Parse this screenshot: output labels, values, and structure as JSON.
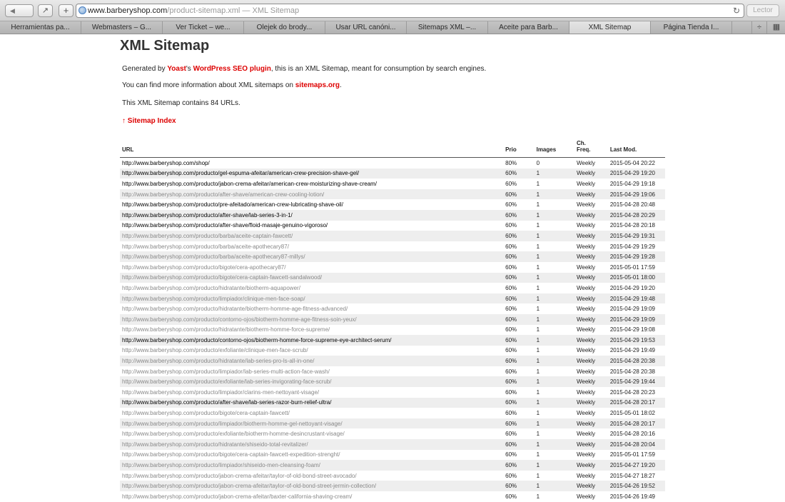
{
  "browser": {
    "address_host": "www.barberyshop.com",
    "address_path": "/product-sitemap.xml — XML Sitemap",
    "reader_label": "Lector",
    "tabs": [
      {
        "label": "Herramientas pa...",
        "active": false
      },
      {
        "label": "Webmasters – G...",
        "active": false
      },
      {
        "label": "Ver Ticket – we...",
        "active": false
      },
      {
        "label": "Olejek do brody...",
        "active": false
      },
      {
        "label": "Usar URL canóni...",
        "active": false
      },
      {
        "label": "Sitemaps XML –...",
        "active": false
      },
      {
        "label": "Aceite para Barb...",
        "active": false
      },
      {
        "label": "XML Sitemap",
        "active": true
      },
      {
        "label": "Página Tienda I...",
        "active": false
      }
    ]
  },
  "page": {
    "title": "XML Sitemap",
    "intro": {
      "pre": "Generated by ",
      "link1": "Yoast",
      "mid": "'s ",
      "link2": "WordPress SEO plugin",
      "post": ", this is an XML Sitemap, meant for consumption by search engines."
    },
    "info": {
      "pre": "You can find more information about XML sitemaps on ",
      "link": "sitemaps.org",
      "post": "."
    },
    "count_text": "This XML Sitemap contains 84 URLs.",
    "index_link": "↑ Sitemap Index"
  },
  "table": {
    "headers": {
      "url": "URL",
      "prio": "Prio",
      "images": "Images",
      "freq_line1": "Ch.",
      "freq_line2": "Freq.",
      "mod": "Last Mod."
    },
    "rows": [
      {
        "url": "http://www.barberyshop.com/shop/",
        "prio": "80%",
        "images": "0",
        "freq": "Weekly",
        "mod": "2015-05-04 20:22",
        "visited": false
      },
      {
        "url": "http://www.barberyshop.com/producto/gel-espuma-afeitar/american-crew-precision-shave-gel/",
        "prio": "60%",
        "images": "1",
        "freq": "Weekly",
        "mod": "2015-04-29 19:20",
        "visited": false
      },
      {
        "url": "http://www.barberyshop.com/producto/jabon-crema-afeitar/american-crew-moisturizing-shave-cream/",
        "prio": "60%",
        "images": "1",
        "freq": "Weekly",
        "mod": "2015-04-29 19:18",
        "visited": false
      },
      {
        "url": "http://www.barberyshop.com/producto/after-shave/american-crew-cooling-lotion/",
        "prio": "60%",
        "images": "1",
        "freq": "Weekly",
        "mod": "2015-04-29 19:06",
        "visited": true
      },
      {
        "url": "http://www.barberyshop.com/producto/pre-afeitado/american-crew-lubricating-shave-oil/",
        "prio": "60%",
        "images": "1",
        "freq": "Weekly",
        "mod": "2015-04-28 20:48",
        "visited": false
      },
      {
        "url": "http://www.barberyshop.com/producto/after-shave/lab-series-3-in-1/",
        "prio": "60%",
        "images": "1",
        "freq": "Weekly",
        "mod": "2015-04-28 20:29",
        "visited": false
      },
      {
        "url": "http://www.barberyshop.com/producto/after-shave/floid-masaje-genuino-vigoroso/",
        "prio": "60%",
        "images": "1",
        "freq": "Weekly",
        "mod": "2015-04-28 20:18",
        "visited": false
      },
      {
        "url": "http://www.barberyshop.com/producto/barba/aceite-captain-fawcett/",
        "prio": "60%",
        "images": "1",
        "freq": "Weekly",
        "mod": "2015-04-29 19:31",
        "visited": true
      },
      {
        "url": "http://www.barberyshop.com/producto/barba/aceite-apothecary87/",
        "prio": "60%",
        "images": "1",
        "freq": "Weekly",
        "mod": "2015-04-29 19:29",
        "visited": true
      },
      {
        "url": "http://www.barberyshop.com/producto/barba/aceite-apothecary87-millys/",
        "prio": "60%",
        "images": "1",
        "freq": "Weekly",
        "mod": "2015-04-29 19:28",
        "visited": true
      },
      {
        "url": "http://www.barberyshop.com/producto/bigote/cera-apothecary87/",
        "prio": "60%",
        "images": "1",
        "freq": "Weekly",
        "mod": "2015-05-01 17:59",
        "visited": true
      },
      {
        "url": "http://www.barberyshop.com/producto/bigote/cera-captain-fawcett-sandalwood/",
        "prio": "60%",
        "images": "1",
        "freq": "Weekly",
        "mod": "2015-05-01 18:00",
        "visited": true
      },
      {
        "url": "http://www.barberyshop.com/producto/hidratante/biotherm-aquapower/",
        "prio": "60%",
        "images": "1",
        "freq": "Weekly",
        "mod": "2015-04-29 19:20",
        "visited": true
      },
      {
        "url": "http://www.barberyshop.com/producto/limpiador/clinique-men-face-soap/",
        "prio": "60%",
        "images": "1",
        "freq": "Weekly",
        "mod": "2015-04-29 19:48",
        "visited": true
      },
      {
        "url": "http://www.barberyshop.com/producto/hidratante/biotherm-homme-age-fitness-advanced/",
        "prio": "60%",
        "images": "1",
        "freq": "Weekly",
        "mod": "2015-04-29 19:09",
        "visited": true
      },
      {
        "url": "http://www.barberyshop.com/producto/contorno-ojos/biotherm-homme-age-fitness-soin-yeux/",
        "prio": "60%",
        "images": "1",
        "freq": "Weekly",
        "mod": "2015-04-29 19:09",
        "visited": true
      },
      {
        "url": "http://www.barberyshop.com/producto/hidratante/biotherm-homme-force-supreme/",
        "prio": "60%",
        "images": "1",
        "freq": "Weekly",
        "mod": "2015-04-29 19:08",
        "visited": true
      },
      {
        "url": "http://www.barberyshop.com/producto/contorno-ojos/biotherm-homme-force-supreme-eye-architect-serum/",
        "prio": "60%",
        "images": "1",
        "freq": "Weekly",
        "mod": "2015-04-29 19:53",
        "visited": false
      },
      {
        "url": "http://www.barberyshop.com/producto/exfoliante/clinique-men-face-scrub/",
        "prio": "60%",
        "images": "1",
        "freq": "Weekly",
        "mod": "2015-04-29 19:49",
        "visited": true
      },
      {
        "url": "http://www.barberyshop.com/producto/hidratante/lab-series-pro-ls-all-in-one/",
        "prio": "60%",
        "images": "1",
        "freq": "Weekly",
        "mod": "2015-04-28 20:38",
        "visited": true
      },
      {
        "url": "http://www.barberyshop.com/producto/limpiador/lab-series-multi-action-face-wash/",
        "prio": "60%",
        "images": "1",
        "freq": "Weekly",
        "mod": "2015-04-28 20:38",
        "visited": true
      },
      {
        "url": "http://www.barberyshop.com/producto/exfoliante/lab-series-invigorating-face-scrub/",
        "prio": "60%",
        "images": "1",
        "freq": "Weekly",
        "mod": "2015-04-29 19:44",
        "visited": true
      },
      {
        "url": "http://www.barberyshop.com/producto/limpiador/clarins-men-nettoyant-visage/",
        "prio": "60%",
        "images": "1",
        "freq": "Weekly",
        "mod": "2015-04-28 20:23",
        "visited": true
      },
      {
        "url": "http://www.barberyshop.com/producto/after-shave/lab-series-razor-burn-relief-ultra/",
        "prio": "60%",
        "images": "1",
        "freq": "Weekly",
        "mod": "2015-04-28 20:17",
        "visited": false
      },
      {
        "url": "http://www.barberyshop.com/producto/bigote/cera-captain-fawcett/",
        "prio": "60%",
        "images": "1",
        "freq": "Weekly",
        "mod": "2015-05-01 18:02",
        "visited": true
      },
      {
        "url": "http://www.barberyshop.com/producto/limpiador/biotherm-homme-gel-nettoyant-visage/",
        "prio": "60%",
        "images": "1",
        "freq": "Weekly",
        "mod": "2015-04-28 20:17",
        "visited": true
      },
      {
        "url": "http://www.barberyshop.com/producto/exfoliante/biotherm-homme-desincrustant-visage/",
        "prio": "60%",
        "images": "1",
        "freq": "Weekly",
        "mod": "2015-04-28 20:16",
        "visited": true
      },
      {
        "url": "http://www.barberyshop.com/producto/hidratante/shiseido-total-revitalizer/",
        "prio": "60%",
        "images": "1",
        "freq": "Weekly",
        "mod": "2015-04-28 20:04",
        "visited": true
      },
      {
        "url": "http://www.barberyshop.com/producto/bigote/cera-captain-fawcett-expedition-strenght/",
        "prio": "60%",
        "images": "1",
        "freq": "Weekly",
        "mod": "2015-05-01 17:59",
        "visited": true
      },
      {
        "url": "http://www.barberyshop.com/producto/limpiador/shiseido-men-cleansing-foam/",
        "prio": "60%",
        "images": "1",
        "freq": "Weekly",
        "mod": "2015-04-27 19:20",
        "visited": true
      },
      {
        "url": "http://www.barberyshop.com/producto/jabon-crema-afeitar/taylor-of-old-bond-street-avocado/",
        "prio": "60%",
        "images": "1",
        "freq": "Weekly",
        "mod": "2015-04-27 18:27",
        "visited": true
      },
      {
        "url": "http://www.barberyshop.com/producto/jabon-crema-afeitar/taylor-of-old-bond-street-jermin-collection/",
        "prio": "60%",
        "images": "1",
        "freq": "Weekly",
        "mod": "2015-04-26 19:52",
        "visited": true
      },
      {
        "url": "http://www.barberyshop.com/producto/jabon-crema-afeitar/baxter-california-shaving-cream/",
        "prio": "60%",
        "images": "1",
        "freq": "Weekly",
        "mod": "2015-04-26 19:49",
        "visited": true
      }
    ]
  }
}
